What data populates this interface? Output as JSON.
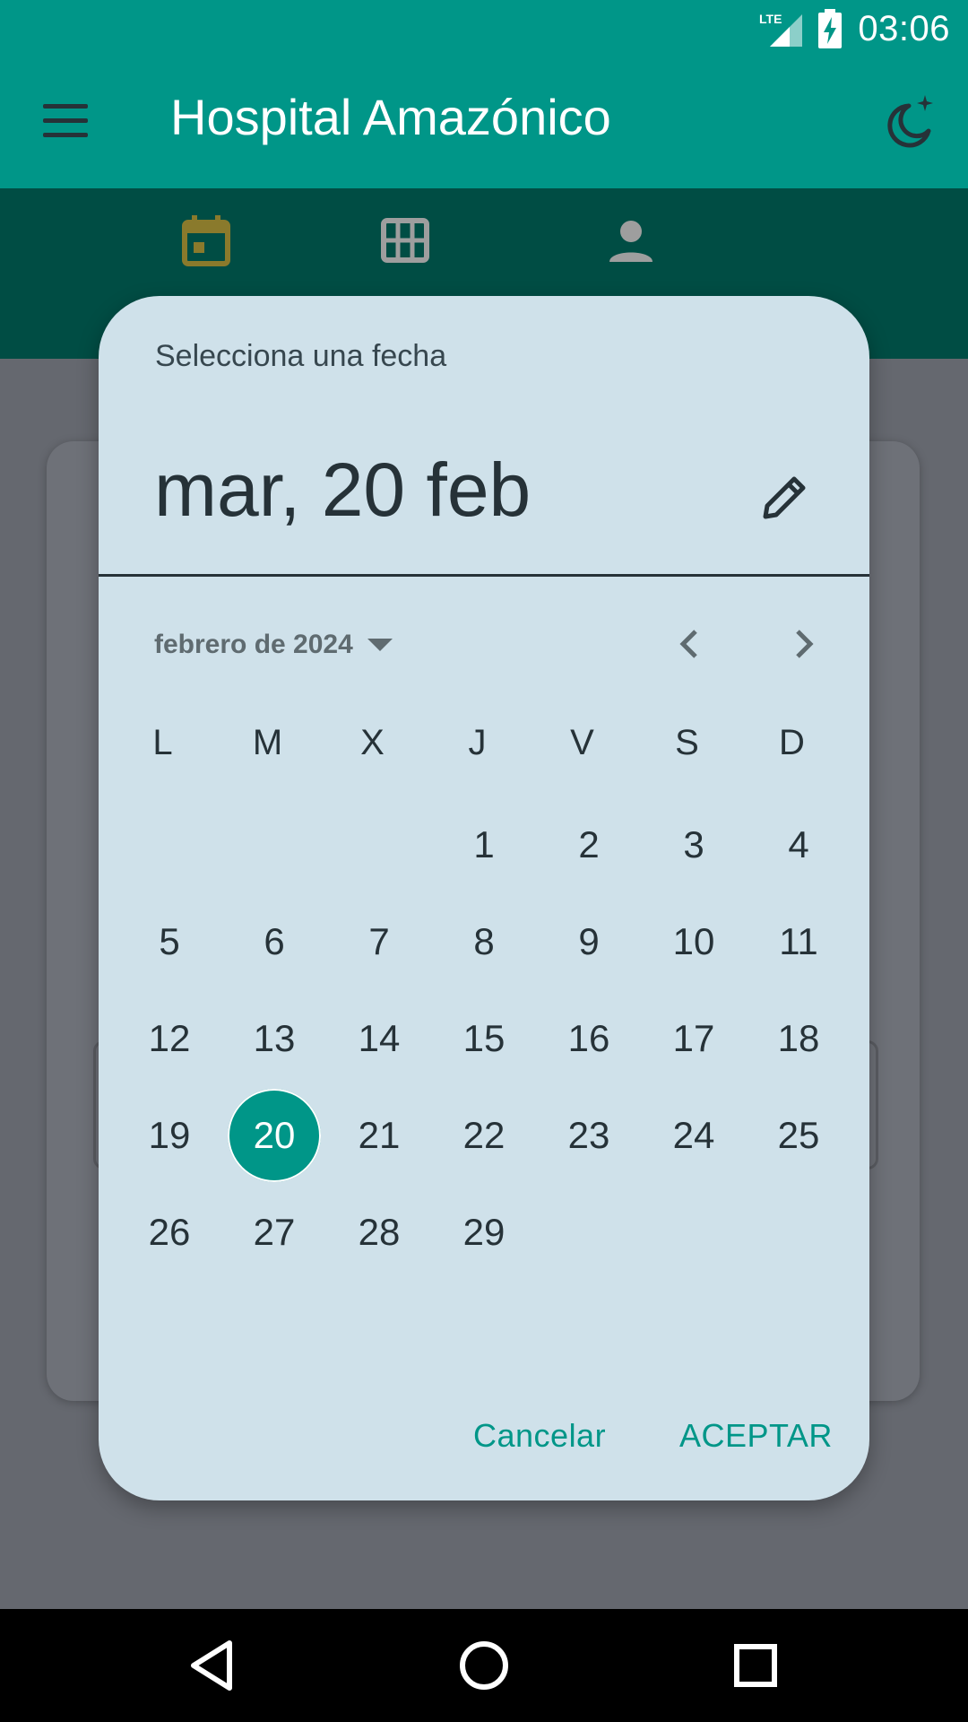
{
  "status_bar": {
    "network_label": "LTE",
    "time": "03:06"
  },
  "app_bar": {
    "menu_icon": "hamburger-menu-icon",
    "title": "Hospital Amazónico",
    "theme_icon": "night-mode-moon-icon"
  },
  "tabs": [
    {
      "icon": "calendar-icon",
      "active": true,
      "color": "#8a7a2c"
    },
    {
      "icon": "grid-icon",
      "active": false,
      "color": "#9e9e9e"
    },
    {
      "icon": "person-icon",
      "active": false,
      "color": "#9e9e9e"
    }
  ],
  "dialog": {
    "header_label": "Selecciona una fecha",
    "selected_date_text": "mar, 20 feb",
    "edit_icon": "pencil-icon",
    "month_label": "febrero de 2024",
    "dropdown_icon": "dropdown-arrow-icon",
    "prev_icon": "chevron-left-icon",
    "next_icon": "chevron-right-icon",
    "weekdays": [
      "L",
      "M",
      "X",
      "J",
      "V",
      "S",
      "D"
    ],
    "weeks": [
      [
        "",
        "",
        "",
        "1",
        "2",
        "3",
        "4"
      ],
      [
        "5",
        "6",
        "7",
        "8",
        "9",
        "10",
        "11"
      ],
      [
        "12",
        "13",
        "14",
        "15",
        "16",
        "17",
        "18"
      ],
      [
        "19",
        "20",
        "21",
        "22",
        "23",
        "24",
        "25"
      ],
      [
        "26",
        "27",
        "28",
        "29",
        "",
        "",
        ""
      ]
    ],
    "selected_day": "20",
    "cancel_label": "Cancelar",
    "accept_label": "ACEPTAR"
  },
  "colors": {
    "primary": "#009688",
    "primary_dark": "#004d44",
    "dialog_bg": "#cfe1ea",
    "scrim": "#65686f"
  },
  "navigation_bar": {
    "back_icon": "back-triangle-icon",
    "home_icon": "home-circle-icon",
    "recents_icon": "recents-square-icon"
  }
}
